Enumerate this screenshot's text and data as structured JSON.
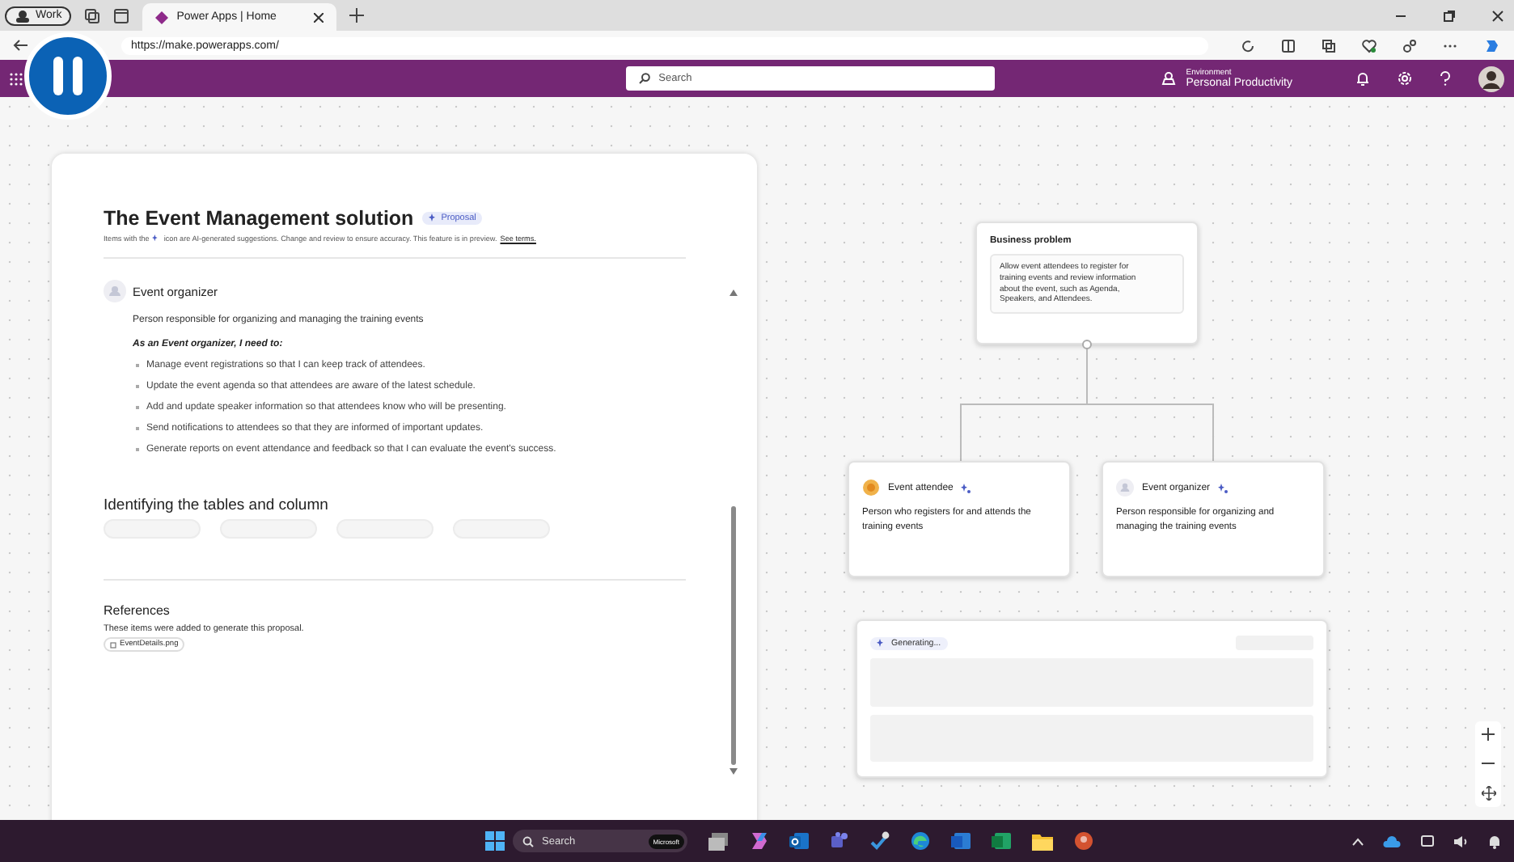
{
  "browser": {
    "profile": "Work",
    "tab_title": "Power Apps | Home",
    "url": "https://make.powerapps.com/"
  },
  "app_bar": {
    "search_placeholder": "Search",
    "environment_label": "Environment",
    "environment_name": "Personal Productivity"
  },
  "proposal": {
    "title": "The Event Management solution",
    "badge": "Proposal",
    "note_before": "Items with the",
    "note_after": "icon are AI-generated suggestions. Change and review to ensure accuracy. This feature is in preview.",
    "note_link": "See terms."
  },
  "persona": {
    "name": "Event organizer",
    "description": "Person responsible for organizing and managing the training events",
    "intro": "As an Event organizer, I need to:",
    "needs": [
      "Manage event registrations so that I can keep track of attendees.",
      "Update the event agenda so that attendees are aware of the latest schedule.",
      "Add and update speaker information so that attendees know who will be presenting.",
      "Send notifications to attendees so that they are informed of important updates.",
      "Generate reports on event attendance and feedback so that I can evaluate the event's success."
    ]
  },
  "tables_section": {
    "heading": "Identifying the tables and column"
  },
  "references": {
    "heading": "References",
    "description": "These items were added to generate this proposal.",
    "files": [
      "EventDetails.png"
    ]
  },
  "diagram": {
    "business_problem": {
      "title": "Business problem",
      "text": "Allow event attendees to register for training events and review information about the event, such as Agenda, Speakers, and Attendees."
    },
    "personas": [
      {
        "name": "Event attendee",
        "description": "Person who registers for and attends the training events",
        "kind": "attendee"
      },
      {
        "name": "Event organizer",
        "description": "Person responsible for organizing and managing the training events",
        "kind": "organizer"
      }
    ],
    "generating": {
      "label": "Generating..."
    }
  },
  "taskbar": {
    "search_placeholder": "Search",
    "badge": "Microsoft"
  }
}
